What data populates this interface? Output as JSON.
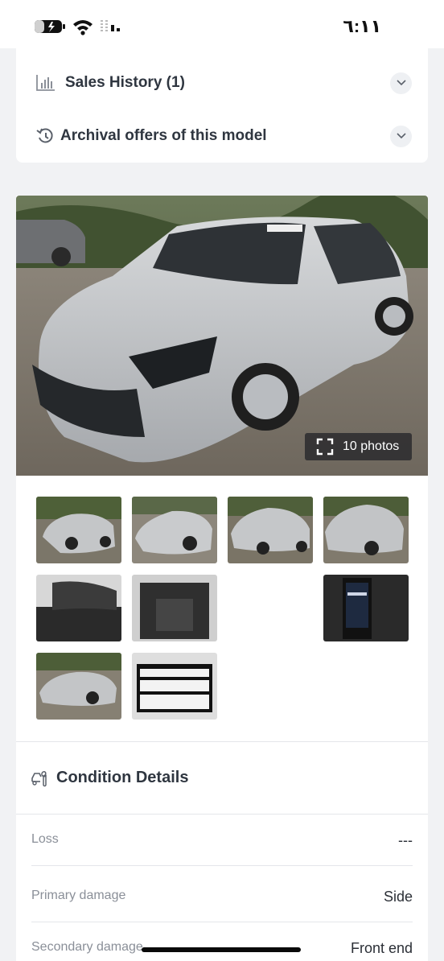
{
  "status_bar": {
    "time": "٦:١١"
  },
  "accordion": {
    "sales_history_label": "Sales History (1)",
    "archival_offers_label": "Archival offers of this model"
  },
  "photos": {
    "count_label": "10 photos",
    "thumbnails": [
      "thumb-1",
      "thumb-2",
      "thumb-3",
      "thumb-4",
      "thumb-5",
      "thumb-6",
      "thumb-7",
      "thumb-8",
      "thumb-9"
    ]
  },
  "condition": {
    "title": "Condition Details",
    "rows": [
      {
        "label": "Loss",
        "value": "---"
      },
      {
        "label": "Primary damage",
        "value": "Side"
      },
      {
        "label": "Secondary damage",
        "value": "Front end"
      }
    ]
  },
  "colors": {
    "accent_text": "#2f3640",
    "muted_text": "#8a8f98",
    "background": "#f1f2f4"
  }
}
